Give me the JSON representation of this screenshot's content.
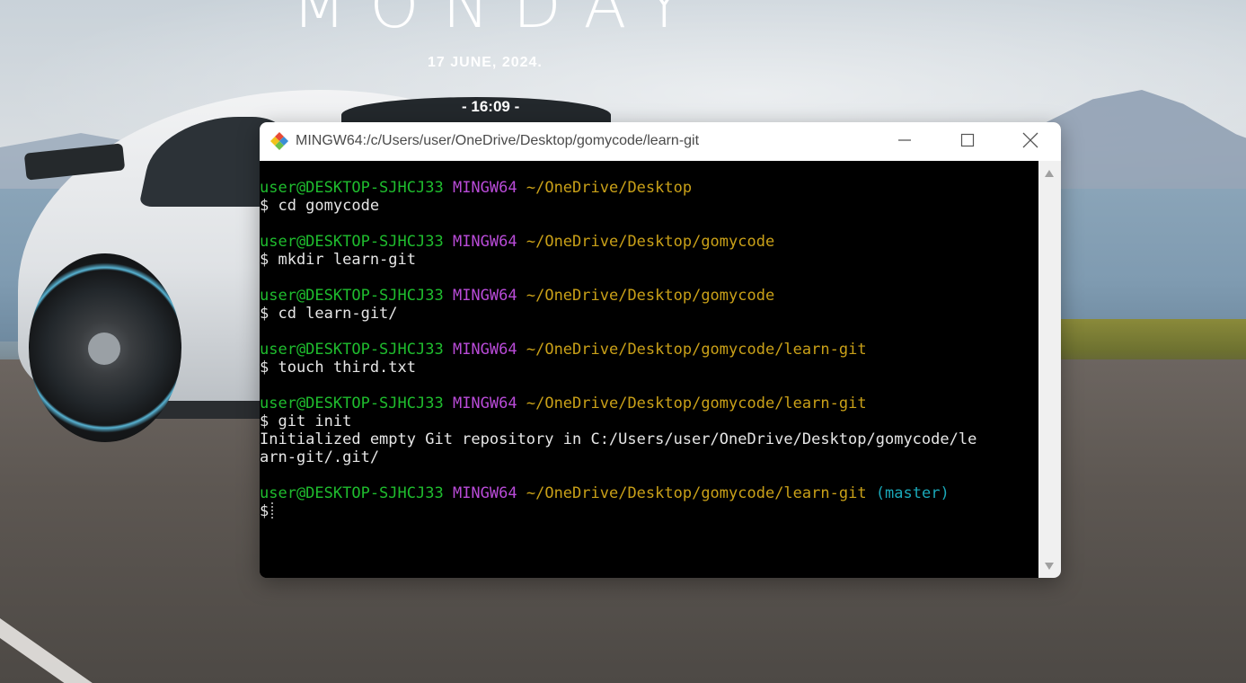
{
  "desktop": {
    "day": "MONDAY",
    "date": "17 JUNE, 2024.",
    "time": "- 16:09 -"
  },
  "window": {
    "title": "MINGW64:/c/Users/user/OneDrive/Desktop/gomycode/learn-git",
    "app_icon": "git-bash-icon",
    "buttons": {
      "minimize": "minimize-icon",
      "maximize": "maximize-icon",
      "close": "close-icon"
    }
  },
  "terminal": {
    "colors": {
      "user": "#1fbd2e",
      "system": "#b94bd8",
      "path": "#c9a018",
      "branch": "#1aa8b8",
      "text": "#e6e6e6"
    },
    "blocks": [
      {
        "user": "user@DESKTOP-SJHCJ33",
        "system": "MINGW64",
        "path": "~/OneDrive/Desktop",
        "command": "$ cd gomycode"
      },
      {
        "user": "user@DESKTOP-SJHCJ33",
        "system": "MINGW64",
        "path": "~/OneDrive/Desktop/gomycode",
        "command": "$ mkdir learn-git"
      },
      {
        "user": "user@DESKTOP-SJHCJ33",
        "system": "MINGW64",
        "path": "~/OneDrive/Desktop/gomycode",
        "command": "$ cd learn-git/"
      },
      {
        "user": "user@DESKTOP-SJHCJ33",
        "system": "MINGW64",
        "path": "~/OneDrive/Desktop/gomycode/learn-git",
        "command": "$ touch third.txt"
      },
      {
        "user": "user@DESKTOP-SJHCJ33",
        "system": "MINGW64",
        "path": "~/OneDrive/Desktop/gomycode/learn-git",
        "command": "$ git init",
        "output": [
          "Initialized empty Git repository in C:/Users/user/OneDrive/Desktop/gomycode/le",
          "arn-git/.git/"
        ]
      },
      {
        "user": "user@DESKTOP-SJHCJ33",
        "system": "MINGW64",
        "path": "~/OneDrive/Desktop/gomycode/learn-git",
        "branch": "(master)",
        "command": "$"
      }
    ]
  }
}
